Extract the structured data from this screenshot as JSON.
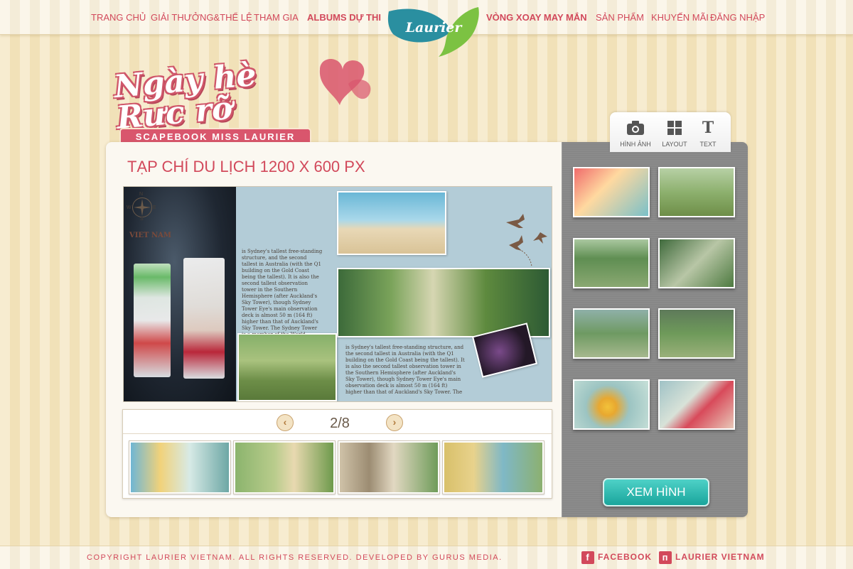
{
  "nav": {
    "items": [
      {
        "label": "TRANG CHỦ",
        "bold": false
      },
      {
        "label": "GIẢI THƯỞNG&THỂ LỆ",
        "bold": false
      },
      {
        "label": "THAM GIA",
        "bold": false
      },
      {
        "label": "ALBUMS DỰ THI",
        "bold": true
      },
      {
        "label": "VÒNG XOAY MAY MẮN",
        "bold": true
      },
      {
        "label": "SẢN PHẨM",
        "bold": false
      },
      {
        "label": "KHUYẾN MÃI",
        "bold": false
      },
      {
        "label": "ĐĂNG NHẬP",
        "bold": false
      }
    ],
    "logo_text": "Laurier"
  },
  "hero": {
    "title": "Ngày hè Rực rỡ",
    "ribbon": "SCAPEBOOK MISS LAURIER"
  },
  "canvas": {
    "title": "TẠP CHÍ DU LỊCH  1200 X 600 PX",
    "heading": "VIET NAM",
    "body_text_1": "is Sydney's tallest free-standing structure, and the second tallest in Australia (with the Q1 building on the Gold Coast being the tallest). It is also the second tallest observation tower in the Southern Hemisphere (after Auckland's Sky Tower), though Sydney Tower Eye's main observation deck is almost 50 m (164 ft) higher than that of Auckland's Sky Tower. The Sydney Tower is a member of the World Federation of Great Towers.",
    "body_text_2": "is Sydney's tallest free-standing structure, and the second tallest in Australia (with the Q1 building on the Gold Coast being the tallest). It is also the second tallest observation tower in the Southern Hemisphere (after Auckland's Sky Tower), though Sydney Tower Eye's main observation deck is almost 50 m (164 ft) higher than that of Auckland's Sky Tower. The Sydney Tower is a member of the World Federation of Great Towers.",
    "compass": {
      "n": "N",
      "s": "S",
      "w": "W",
      "e": "E"
    }
  },
  "pager": {
    "prev_icon": "chevron-left-icon",
    "next_icon": "chevron-right-icon",
    "prev_glyph": "‹",
    "next_glyph": "›",
    "current": "2/8"
  },
  "tabs": [
    {
      "label": "HÌNH ẢNH",
      "icon": "camera-icon",
      "glyph": "◉"
    },
    {
      "label": "LAYOUT",
      "icon": "layout-grid-icon",
      "glyph": "▦"
    },
    {
      "label": "TEXT",
      "icon": "text-icon",
      "glyph": "T"
    }
  ],
  "view_button": "XEM HÌNH",
  "footer": {
    "copyright": "COPYRIGHT LAURIER VIETNAM. ALL RIGHTS RESERVED. DEVELOPED BY GURUS MEDIA.",
    "facebook": "FACEBOOK",
    "facebook_glyph": "f",
    "laurier": "LAURIER VIETNAM",
    "laurier_glyph": "п"
  },
  "colors": {
    "accent": "#d2495b",
    "teal_button": "#1aa59c",
    "sidebar_gray": "#878787"
  }
}
